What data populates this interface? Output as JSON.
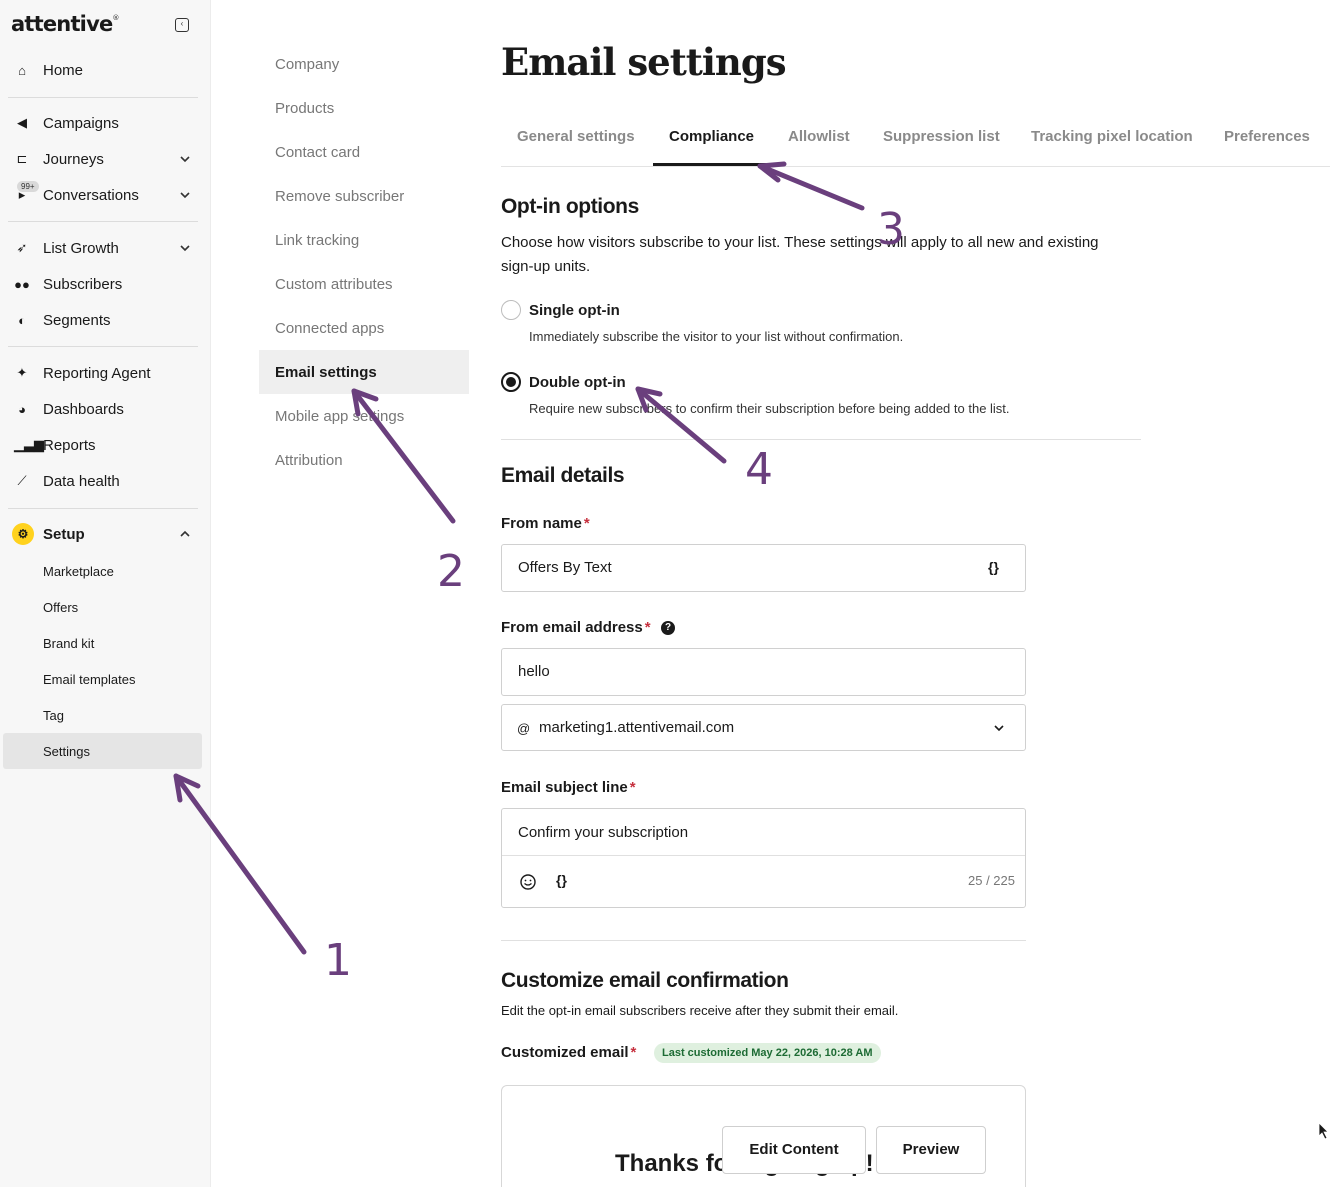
{
  "sidebar": {
    "logo": "attentive",
    "logo_mark": "®",
    "collapse_icon": "sidebar-collapse-icon",
    "badge": "99+",
    "items": [
      {
        "label": "Home",
        "icon": "home-icon"
      },
      {
        "label": "Campaigns",
        "icon": "megaphone-icon"
      },
      {
        "label": "Journeys",
        "icon": "journeys-icon"
      },
      {
        "label": "Conversations",
        "icon": "chat-icon"
      },
      {
        "label": "List Growth",
        "icon": "rocket-icon"
      },
      {
        "label": "Subscribers",
        "icon": "users-icon"
      },
      {
        "label": "Segments",
        "icon": "segments-icon"
      },
      {
        "label": "Reporting Agent",
        "icon": "sparkle-icon"
      },
      {
        "label": "Dashboards",
        "icon": "pie-icon"
      },
      {
        "label": "Reports",
        "icon": "bar-chart-icon"
      },
      {
        "label": "Data health",
        "icon": "line-chart-icon"
      },
      {
        "label": "Setup",
        "icon": "gear-icon"
      }
    ],
    "setup_items": [
      "Marketplace",
      "Offers",
      "Brand kit",
      "Email templates",
      "Tag",
      "Settings"
    ]
  },
  "subnav": {
    "items": [
      "Company",
      "Products",
      "Contact card",
      "Remove subscriber",
      "Link tracking",
      "Custom attributes",
      "Connected apps",
      "Email settings",
      "Mobile app settings",
      "Attribution"
    ]
  },
  "main": {
    "title": "Email settings",
    "tabs": [
      "General settings",
      "Compliance",
      "Allowlist",
      "Suppression list",
      "Tracking pixel location",
      "Preferences"
    ],
    "optin": {
      "heading": "Opt-in options",
      "desc_line1": "Choose how visitors subscribe to your list. These settings will apply to all new and existing",
      "desc_line2": "sign-up units.",
      "single_title": "Single opt-in",
      "single_desc": "Immediately subscribe the visitor to your list without confirmation.",
      "double_title": "Double opt-in",
      "double_desc": "Require new subscribers to confirm their subscription before being added to the list."
    },
    "details": {
      "heading": "Email details",
      "from_name_label": "From name",
      "from_name_value": "Offers By Text",
      "from_email_label": "From email address",
      "from_email_value": "hello",
      "domain_at": "@",
      "domain_value": "marketing1.attentivemail.com",
      "subject_label": "Email subject line",
      "subject_value": "Confirm your subscription",
      "subject_counter": "25 / 225",
      "required_mark": "*",
      "help_mark": "?",
      "braces": "{}"
    },
    "confirmation": {
      "heading": "Customize email confirmation",
      "desc": "Edit the opt-in email subscribers receive after they submit their email.",
      "customized_label": "Customized email",
      "status": "Last customized May 22, 2026, 10:28 AM",
      "preview_heading": "Thanks for signing up!",
      "edit_button": "Edit Content",
      "preview_button": "Preview"
    }
  },
  "annotations": [
    "1",
    "2",
    "3",
    "4"
  ],
  "colors": {
    "annotation": "#6a3f7d",
    "setup_icon_bg": "#ffd21e",
    "required": "#c6303e",
    "status_bg": "#dff0df",
    "status_text": "#1d6b34"
  }
}
